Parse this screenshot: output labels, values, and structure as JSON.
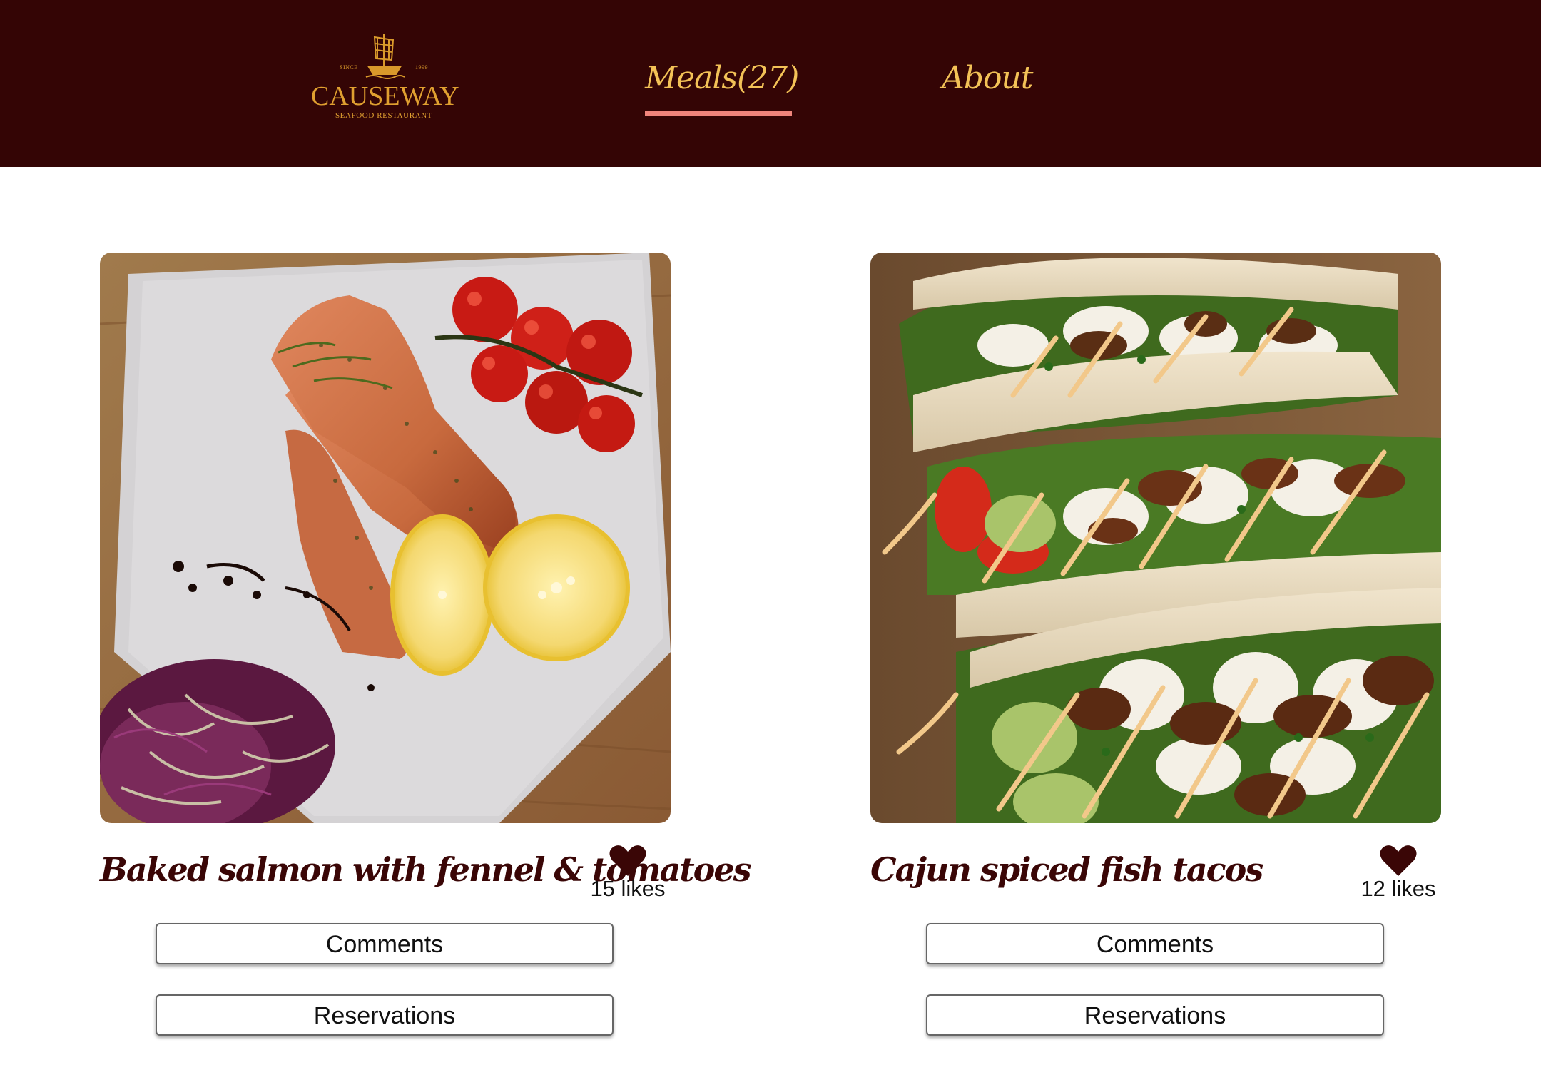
{
  "header": {
    "logo": {
      "name": "CAUSEWAY",
      "subtitle": "SEAFOOD RESTAURANT",
      "since_label": "SINCE",
      "since_year": "1999",
      "icon": "ship-icon"
    },
    "nav": [
      {
        "label": "Meals(27)",
        "active": true
      },
      {
        "label": "About",
        "active": false
      }
    ],
    "colors": {
      "background": "#340505",
      "nav_text": "#f3c257",
      "active_underline": "#f0857c",
      "logo": "#e0a030"
    }
  },
  "meals": [
    {
      "title": "Baked salmon with fennel & tomatoes",
      "likes": "15 likes",
      "comments_label": "Comments",
      "reservations_label": "Reservations",
      "image": "salmon-photo",
      "like_icon": "heart-icon"
    },
    {
      "title": "Cajun spiced fish tacos",
      "likes": "12 likes",
      "comments_label": "Comments",
      "reservations_label": "Reservations",
      "image": "tacos-photo",
      "like_icon": "heart-icon"
    }
  ],
  "colors": {
    "title_text": "#3a0606",
    "heart": "#3a0606"
  }
}
